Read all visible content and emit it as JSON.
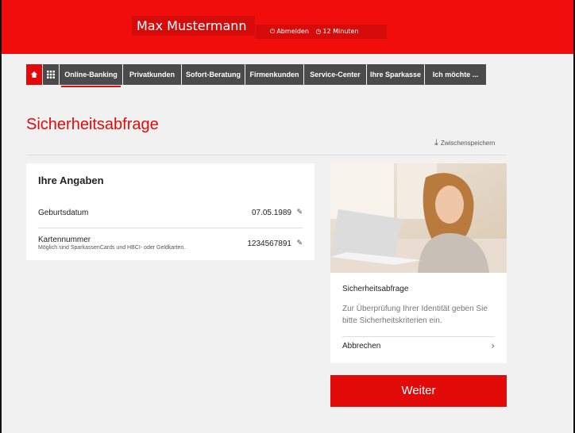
{
  "header": {
    "user_name": "Max Mustermann",
    "logout_label": "Abmelden",
    "session_time": "12 Minuten"
  },
  "nav": {
    "items": [
      "Online-Banking",
      "Privatkunden",
      "Sofort-Beratung",
      "Firmenkunden",
      "Service-Center",
      "Ihre Sparkasse",
      "Ich möchte ..."
    ]
  },
  "page": {
    "title": "Sicherheitsabfrage",
    "save_label": "Zwischenspeichern"
  },
  "form": {
    "title": "Ihre Angaben",
    "birthdate_label": "Geburtsdatum",
    "birthdate_value": "07.05.1989",
    "card_label": "Kartennummer",
    "card_hint": "Möglich sind SparkassenCards und HBCI- oder Geldkarten.",
    "card_value": "1234567891"
  },
  "info": {
    "title": "Sicherheitsabfrage",
    "text": "Zur Überprüfung Ihrer Identität geben Sie bitte Sicherheitskriterien ein.",
    "cancel_label": "Abbrechen"
  },
  "actions": {
    "continue_label": "Weiter"
  },
  "colors": {
    "brand_red": "#e30a0a",
    "nav_dark": "#4b4b4b"
  }
}
